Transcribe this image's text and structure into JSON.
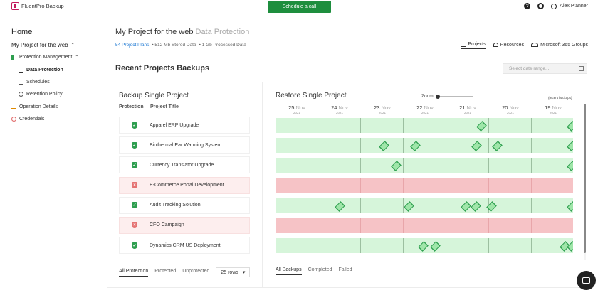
{
  "topbar": {
    "brand": "FluentPro Backup",
    "cta": "Schedule a call",
    "help_glyph": "?",
    "user_name": "Alex Planner"
  },
  "sidebar": {
    "home": "Home",
    "project": "My Project for the web",
    "items": [
      {
        "label": "Protection Management"
      },
      {
        "label": "Data Protection"
      },
      {
        "label": "Schedules"
      },
      {
        "label": "Retention Policy"
      },
      {
        "label": "Operation Details"
      },
      {
        "label": "Credentials"
      }
    ]
  },
  "header": {
    "title": "My Project for the web",
    "subtitle": "Data Protection",
    "stats": {
      "plans": "54 Project Plans",
      "stored": "• 512 Mb Stored Data",
      "processed": "• 1 Gb Processed Data"
    },
    "tabs": [
      "Projects",
      "Resources",
      "Microsoft 365 Groups"
    ]
  },
  "section": {
    "title": "Recent Projects Backups",
    "date_placeholder": "Select date range..."
  },
  "backup_panel": {
    "title": "Backup Single Project",
    "col_protection": "Protection",
    "col_title": "Project Title",
    "rows": [
      {
        "title": "Apparel ERP Upgrade",
        "status": "ok"
      },
      {
        "title": "Biothermal Ear Warming System",
        "status": "ok"
      },
      {
        "title": "Currency Translator Upgrade",
        "status": "ok"
      },
      {
        "title": "E-Commerce Portal Development",
        "status": "fail"
      },
      {
        "title": "Audit Tracking Solution",
        "status": "ok"
      },
      {
        "title": "CFO Campaign",
        "status": "fail"
      },
      {
        "title": "Dynamics CRM US Deployment",
        "status": "ok"
      }
    ],
    "filters": [
      "All Protection",
      "Protected",
      "Unprotected"
    ],
    "rows_select": "25 rows",
    "rows_caret": "▾"
  },
  "restore_panel": {
    "title": "Restore Single Project",
    "zoom_label": "Zoom",
    "recent_label": "(recent backups)",
    "dates": [
      {
        "day": "25",
        "mon": "Nov",
        "year": "2021"
      },
      {
        "day": "24",
        "mon": "Nov",
        "year": "2021"
      },
      {
        "day": "23",
        "mon": "Nov",
        "year": "2021"
      },
      {
        "day": "22",
        "mon": "Nov",
        "year": "2021"
      },
      {
        "day": "21",
        "mon": "Nov",
        "year": "2021"
      },
      {
        "day": "20",
        "mon": "Nov",
        "year": "2021"
      },
      {
        "day": "19",
        "mon": "Nov",
        "year": "2021"
      }
    ],
    "filters": [
      "All Backups",
      "Completed",
      "Failed"
    ]
  },
  "colors": {
    "cta": "#1e8e3e",
    "ok": "#2e9e4f",
    "fail": "#e57373",
    "row_ok": "#d6f5da",
    "row_fail": "#f6c3c6",
    "link": "#1976d2"
  },
  "icons": [
    "question-icon",
    "gear-icon",
    "user-icon",
    "chevron-up-icon",
    "calendar-icon",
    "chat-icon",
    "shield-check-icon",
    "shield-x-icon"
  ]
}
